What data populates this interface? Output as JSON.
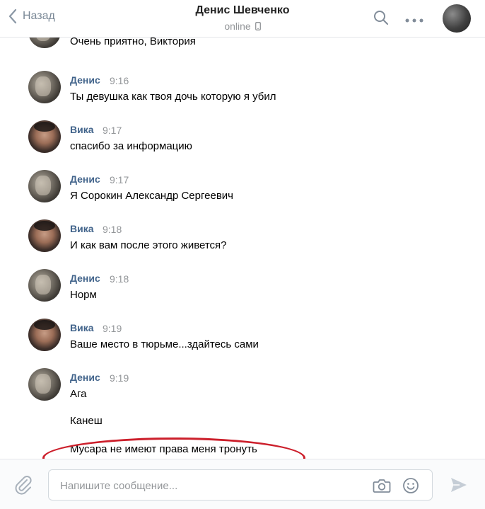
{
  "header": {
    "back_label": "Назад",
    "title": "Денис Шевченко",
    "status": "online"
  },
  "messages": [
    {
      "author": "",
      "time": "",
      "text": "Очень приятно, Виктория",
      "avatar": "denis"
    },
    {
      "author": "Денис",
      "time": "9:16",
      "text": "Ты девушка как твоя дочь которую я убил",
      "avatar": "denis"
    },
    {
      "author": "Вика",
      "time": "9:17",
      "text": "спасибо за информацию",
      "avatar": "vika"
    },
    {
      "author": "Денис",
      "time": "9:17",
      "text": "Я Сорокин Александр Сергеевич",
      "avatar": "denis"
    },
    {
      "author": "Вика",
      "time": "9:18",
      "text": "И как вам после этого живется?",
      "avatar": "vika"
    },
    {
      "author": "Денис",
      "time": "9:18",
      "text": "Норм",
      "avatar": "denis"
    },
    {
      "author": "Вика",
      "time": "9:19",
      "text": "Ваше место в тюрьме...здайтесь сами",
      "avatar": "vika"
    },
    {
      "author": "Денис",
      "time": "9:19",
      "text": "Ага",
      "avatar": "denis"
    },
    {
      "author": "",
      "time": "",
      "text": "Канеш",
      "avatar": ""
    },
    {
      "author": "",
      "time": "",
      "text": "Мусара не имеют права меня тронуть",
      "avatar": ""
    }
  ],
  "composer": {
    "placeholder": "Напишите сообщение..."
  },
  "icons": {
    "back": "chevron-left-icon",
    "search": "search-icon",
    "more": "more-dots-icon",
    "phone": "phone-icon",
    "attach": "paperclip-icon",
    "camera": "camera-icon",
    "emoji": "smile-icon",
    "send": "send-icon"
  },
  "colors": {
    "author": "#42648b",
    "highlight": "#cc1f2b",
    "muted": "#939699"
  }
}
